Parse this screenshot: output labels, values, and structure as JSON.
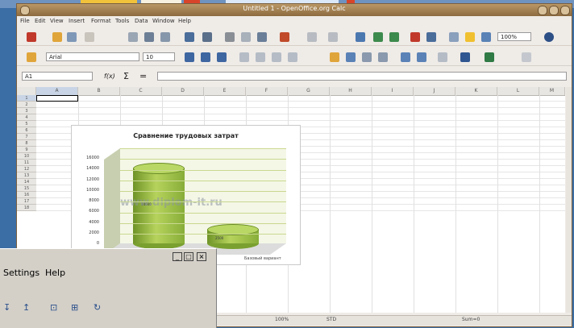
{
  "window": {
    "title": "Untitled 1 - OpenOffice.org Calc"
  },
  "menubar": [
    "File",
    "Edit",
    "View",
    "Insert",
    "Format",
    "Tools",
    "Data",
    "Window",
    "Help"
  ],
  "toolbar_format": {
    "font_name": "Arial",
    "font_size": "10",
    "zoom": "100%"
  },
  "formula_bar": {
    "cell_ref": "A1",
    "fx": "f(x)",
    "sum": "Σ",
    "equals": "="
  },
  "columns": [
    "A",
    "B",
    "C",
    "D",
    "E",
    "F",
    "G",
    "H",
    "I",
    "J",
    "K",
    "L",
    "M"
  ],
  "rows": [
    "1",
    "2",
    "3",
    "4",
    "5",
    "6",
    "7",
    "8",
    "9",
    "10",
    "11",
    "12",
    "13",
    "14",
    "15",
    "16",
    "17",
    "18"
  ],
  "chart_data": {
    "type": "bar",
    "title": "Сравнение трудовых затрат",
    "categories": [
      "",
      "Базовый вариант"
    ],
    "values": [
      14000,
      2500
    ],
    "ylim": [
      0,
      16000
    ],
    "y_ticks": [
      "16000",
      "14000",
      "12000",
      "10000",
      "8000",
      "6000",
      "4000",
      "2000",
      "0"
    ],
    "data_labels": [
      "14000",
      "2500"
    ],
    "colors": {
      "bar": "#9fc24a",
      "grid": "#c9d88f"
    },
    "grid": true,
    "watermark": "www.diplom-it.ru"
  },
  "statusbar": {
    "zoom": "100%",
    "mode": "STD",
    "sum": "Sum=0"
  },
  "small_window": {
    "menu": [
      "Settings",
      "Help"
    ],
    "buttons": [
      "_",
      "□",
      "×"
    ],
    "icons": [
      "sort-asc-icon",
      "sort-desc-icon",
      "select-icon",
      "filter-icon",
      "refresh-icon"
    ]
  }
}
